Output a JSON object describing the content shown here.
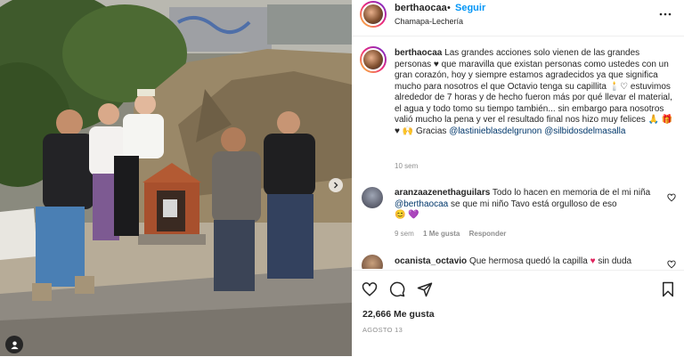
{
  "post": {
    "username": "berthaocaa",
    "follow_label": "Seguir",
    "location": "Chamapa-Lechería",
    "more_icon": "more-horizontal-icon",
    "caption": {
      "username": "berthaocaa",
      "text": "Las grandes acciones solo vienen de las grandes personas ♥ que maravilla que existan personas como ustedes con un gran corazón, hoy y siempre estamos agradecidos ya que significa mucho para nosotros el que Octavio tenga su capillita 🕯️♡ estuvimos alrededor de 7 horas y de hecho fueron más por qué llevar el material, el agua y todo tomo su tiempo también... sin embargo para nosotros valió mucho la pena y ver el resultado final nos hizo muy felices 🙏 🎁 ♥ 🙌  Gracias",
      "mention1": "@lastinieblasdelgrunon",
      "mention2": "@silbidosdelmasalla",
      "time": "10 sem"
    },
    "comments": [
      {
        "username": "aranzaazenethaguilars",
        "text": "Todo lo hacen en memoria de el mi niña",
        "mention": "@berthaocaa",
        "text2": "se que mi niño Tavo está orgulloso de eso",
        "emojis": "😊 💜",
        "time": "9 sem",
        "likes": "1 Me gusta",
        "reply": "Responder"
      },
      {
        "username": "ocanista_octavio",
        "text": "Que hermosa quedó la capilla",
        "emoji": "♥",
        "text2": "sin duda"
      }
    ],
    "likes": "22,666 Me gusta",
    "date": "AGOSTO 13"
  },
  "media": {
    "next_icon": "chevron-right-icon",
    "user_tag_icon": "user-tag-icon"
  },
  "icons": [
    "heart-icon",
    "comment-icon",
    "share-icon",
    "bookmark-icon"
  ]
}
